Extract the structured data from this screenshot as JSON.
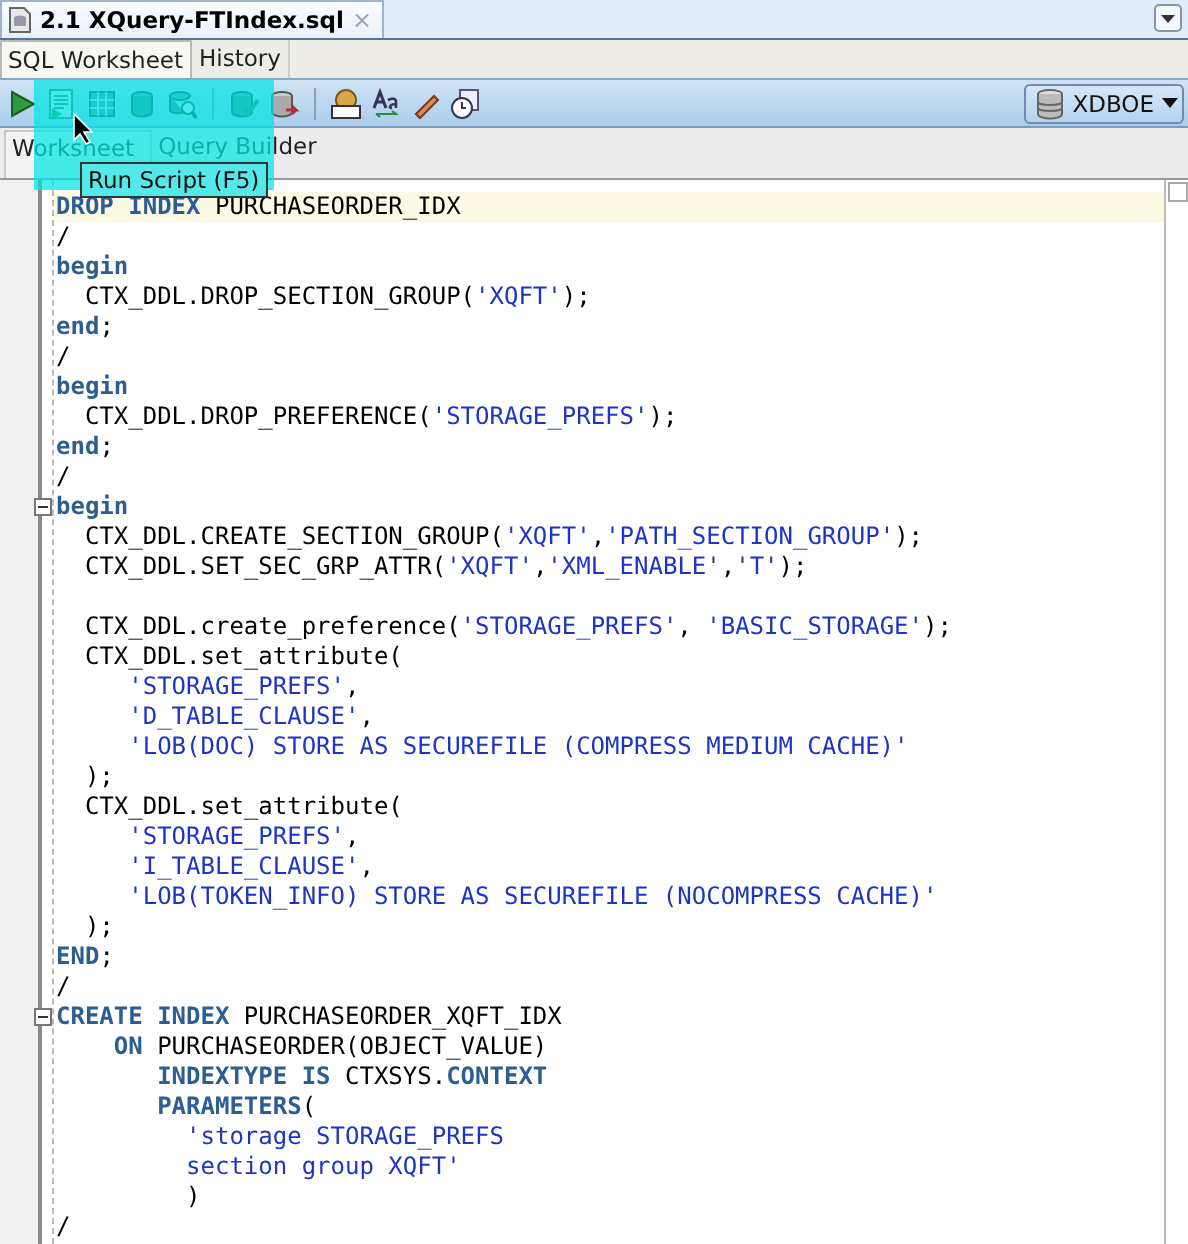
{
  "file_tab": {
    "title": "2.1 XQuery-FTIndex.sql",
    "close": "×",
    "selected": true
  },
  "view_tabs": [
    {
      "label": "SQL Worksheet",
      "selected": true
    },
    {
      "label": "History",
      "selected": false
    }
  ],
  "connection": {
    "name": "XDBOE"
  },
  "editor_tabs": [
    {
      "label": "Worksheet",
      "selected": true
    },
    {
      "label": "Query Builder",
      "selected": false
    }
  ],
  "tooltip": "Run Script (F5)",
  "lines": [
    {
      "foldable": false,
      "current": true,
      "tokens": [
        {
          "kind": "kw",
          "text": "DROP INDEX"
        },
        {
          "kind": "plain",
          "text": " PURCHASEORDER_IDX"
        }
      ]
    },
    {
      "foldable": false,
      "current": false,
      "tokens": [
        {
          "kind": "plain",
          "text": "/"
        }
      ]
    },
    {
      "foldable": false,
      "current": false,
      "tokens": [
        {
          "kind": "kw",
          "text": "begin"
        }
      ]
    },
    {
      "foldable": false,
      "current": false,
      "tokens": [
        {
          "kind": "plain",
          "text": "  CTX_DDL.DROP_SECTION_GROUP("
        },
        {
          "kind": "str",
          "text": "'XQFT'"
        },
        {
          "kind": "plain",
          "text": ");"
        }
      ]
    },
    {
      "foldable": false,
      "current": false,
      "tokens": [
        {
          "kind": "kw",
          "text": "end"
        },
        {
          "kind": "plain",
          "text": ";"
        }
      ]
    },
    {
      "foldable": false,
      "current": false,
      "tokens": [
        {
          "kind": "plain",
          "text": "/"
        }
      ]
    },
    {
      "foldable": false,
      "current": false,
      "tokens": [
        {
          "kind": "kw",
          "text": "begin"
        }
      ]
    },
    {
      "foldable": false,
      "current": false,
      "tokens": [
        {
          "kind": "plain",
          "text": "  CTX_DDL.DROP_PREFERENCE("
        },
        {
          "kind": "str",
          "text": "'STORAGE_PREFS'"
        },
        {
          "kind": "plain",
          "text": ");"
        }
      ]
    },
    {
      "foldable": false,
      "current": false,
      "tokens": [
        {
          "kind": "kw",
          "text": "end"
        },
        {
          "kind": "plain",
          "text": ";"
        }
      ]
    },
    {
      "foldable": false,
      "current": false,
      "tokens": [
        {
          "kind": "plain",
          "text": "/"
        }
      ]
    },
    {
      "foldable": true,
      "current": false,
      "tokens": [
        {
          "kind": "kw",
          "text": "begin"
        }
      ]
    },
    {
      "foldable": false,
      "current": false,
      "tokens": [
        {
          "kind": "plain",
          "text": "  CTX_DDL.CREATE_SECTION_GROUP("
        },
        {
          "kind": "str",
          "text": "'XQFT'"
        },
        {
          "kind": "plain",
          "text": ","
        },
        {
          "kind": "str",
          "text": "'PATH_SECTION_GROUP'"
        },
        {
          "kind": "plain",
          "text": ");"
        }
      ]
    },
    {
      "foldable": false,
      "current": false,
      "tokens": [
        {
          "kind": "plain",
          "text": "  CTX_DDL.SET_SEC_GRP_ATTR("
        },
        {
          "kind": "str",
          "text": "'XQFT'"
        },
        {
          "kind": "plain",
          "text": ","
        },
        {
          "kind": "str",
          "text": "'XML_ENABLE'"
        },
        {
          "kind": "plain",
          "text": ","
        },
        {
          "kind": "str",
          "text": "'T'"
        },
        {
          "kind": "plain",
          "text": ");"
        }
      ]
    },
    {
      "foldable": false,
      "current": false
    },
    {
      "foldable": false,
      "current": false,
      "tokens": [
        {
          "kind": "plain",
          "text": "  CTX_DDL.create_preference("
        },
        {
          "kind": "str",
          "text": "'STORAGE_PREFS'"
        },
        {
          "kind": "plain",
          "text": ", "
        },
        {
          "kind": "str",
          "text": "'BASIC_STORAGE'"
        },
        {
          "kind": "plain",
          "text": ");"
        }
      ]
    },
    {
      "foldable": false,
      "current": false,
      "tokens": [
        {
          "kind": "plain",
          "text": "  CTX_DDL.set_attribute("
        }
      ]
    },
    {
      "foldable": false,
      "current": false,
      "tokens": [
        {
          "kind": "str",
          "text": "     'STORAGE_PREFS'"
        },
        {
          "kind": "plain",
          "text": ","
        }
      ]
    },
    {
      "foldable": false,
      "current": false,
      "tokens": [
        {
          "kind": "str",
          "text": "     'D_TABLE_CLAUSE'"
        },
        {
          "kind": "plain",
          "text": ","
        }
      ]
    },
    {
      "foldable": false,
      "current": false,
      "tokens": [
        {
          "kind": "str",
          "text": "     'LOB(DOC) STORE AS SECUREFILE (COMPRESS MEDIUM CACHE)'"
        }
      ]
    },
    {
      "foldable": false,
      "current": false,
      "tokens": [
        {
          "kind": "plain",
          "text": "  );"
        }
      ]
    },
    {
      "foldable": false,
      "current": false,
      "tokens": [
        {
          "kind": "plain",
          "text": "  CTX_DDL.set_attribute("
        }
      ]
    },
    {
      "foldable": false,
      "current": false,
      "tokens": [
        {
          "kind": "str",
          "text": "     'STORAGE_PREFS'"
        },
        {
          "kind": "plain",
          "text": ","
        }
      ]
    },
    {
      "foldable": false,
      "current": false,
      "tokens": [
        {
          "kind": "str",
          "text": "     'I_TABLE_CLAUSE'"
        },
        {
          "kind": "plain",
          "text": ","
        }
      ]
    },
    {
      "foldable": false,
      "current": false,
      "tokens": [
        {
          "kind": "str",
          "text": "     'LOB(TOKEN_INFO) STORE AS SECUREFILE (NOCOMPRESS CACHE)'"
        }
      ]
    },
    {
      "foldable": false,
      "current": false,
      "tokens": [
        {
          "kind": "plain",
          "text": "  );"
        }
      ]
    },
    {
      "foldable": false,
      "current": false,
      "tokens": [
        {
          "kind": "kw",
          "text": "END"
        },
        {
          "kind": "plain",
          "text": ";"
        }
      ]
    },
    {
      "foldable": false,
      "current": false,
      "tokens": [
        {
          "kind": "plain",
          "text": "/"
        }
      ]
    },
    {
      "foldable": true,
      "current": false,
      "tokens": [
        {
          "kind": "kw",
          "text": "CREATE INDEX"
        },
        {
          "kind": "plain",
          "text": " PURCHASEORDER_XQFT_IDX"
        }
      ]
    },
    {
      "foldable": false,
      "current": false,
      "tokens": [
        {
          "kind": "kw",
          "text": "    ON"
        },
        {
          "kind": "plain",
          "text": " PURCHASEORDER(OBJECT_VALUE)"
        }
      ]
    },
    {
      "foldable": false,
      "current": false,
      "tokens": [
        {
          "kind": "kw",
          "text": "       INDEXTYPE IS"
        },
        {
          "kind": "plain",
          "text": " CTXSYS."
        },
        {
          "kind": "kw",
          "text": "CONTEXT"
        }
      ]
    },
    {
      "foldable": false,
      "current": false,
      "tokens": [
        {
          "kind": "kw",
          "text": "       PARAMETERS"
        },
        {
          "kind": "plain",
          "text": "("
        }
      ]
    },
    {
      "foldable": false,
      "current": false,
      "tokens": [
        {
          "kind": "str",
          "text": "         'storage STORAGE_PREFS"
        }
      ]
    },
    {
      "foldable": false,
      "current": false,
      "tokens": [
        {
          "kind": "str",
          "text": "         section group XQFT'"
        }
      ]
    },
    {
      "foldable": false,
      "current": false,
      "tokens": [
        {
          "kind": "plain",
          "text": "         )"
        }
      ]
    },
    {
      "foldable": false,
      "current": false,
      "tokens": [
        {
          "kind": "plain",
          "text": "/"
        }
      ]
    }
  ]
}
